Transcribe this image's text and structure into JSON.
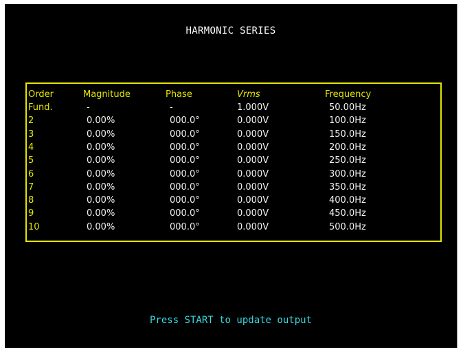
{
  "screen": {
    "title": "HARMONIC SERIES",
    "prompt": "Press START to update output"
  },
  "colors": {
    "background": "#000000",
    "table_border": "#e6e600",
    "header_text": "#e6e600",
    "value_text": "#f2f2f2",
    "prompt_text": "#38d8e0",
    "title_text": "#ffffff"
  },
  "table": {
    "headers": {
      "order": "Order",
      "magnitude": "Magnitude",
      "phase": "Phase",
      "vrms": "Vrms",
      "frequency": "Frequency"
    },
    "rows": [
      {
        "order": "Fund.",
        "magnitude": "-",
        "phase": "-",
        "vrms": "1.000V",
        "frequency": "50.00Hz"
      },
      {
        "order": "2",
        "magnitude": "0.00%",
        "phase": "000.0°",
        "vrms": "0.000V",
        "frequency": "100.0Hz"
      },
      {
        "order": "3",
        "magnitude": "0.00%",
        "phase": "000.0°",
        "vrms": "0.000V",
        "frequency": "150.0Hz"
      },
      {
        "order": "4",
        "magnitude": "0.00%",
        "phase": "000.0°",
        "vrms": "0.000V",
        "frequency": "200.0Hz"
      },
      {
        "order": "5",
        "magnitude": "0.00%",
        "phase": "000.0°",
        "vrms": "0.000V",
        "frequency": "250.0Hz"
      },
      {
        "order": "6",
        "magnitude": "0.00%",
        "phase": "000.0°",
        "vrms": "0.000V",
        "frequency": "300.0Hz"
      },
      {
        "order": "7",
        "magnitude": "0.00%",
        "phase": "000.0°",
        "vrms": "0.000V",
        "frequency": "350.0Hz"
      },
      {
        "order": "8",
        "magnitude": "0.00%",
        "phase": "000.0°",
        "vrms": "0.000V",
        "frequency": "400.0Hz"
      },
      {
        "order": "9",
        "magnitude": "0.00%",
        "phase": "000.0°",
        "vrms": "0.000V",
        "frequency": "450.0Hz"
      },
      {
        "order": "10",
        "magnitude": "0.00%",
        "phase": "000.0°",
        "vrms": "0.000V",
        "frequency": "500.0Hz"
      }
    ]
  }
}
